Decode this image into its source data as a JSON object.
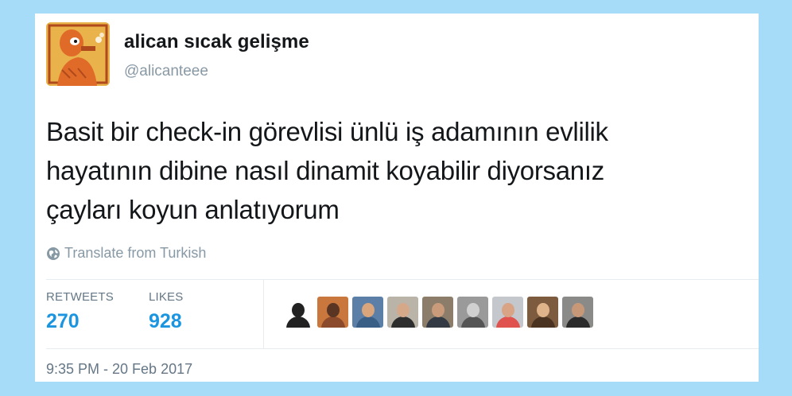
{
  "user": {
    "display_name": "alican sıcak gelişme",
    "handle": "@alicanteee"
  },
  "tweet": {
    "text": "Basit bir check-in görevlisi ünlü iş adamının evlilik\nhayatının dibine nasıl dinamit koyabilir diyorsanız\nçayları koyun anlatıyorum",
    "translate_label": "Translate from Turkish",
    "timestamp": "9:35 PM - 20 Feb 2017"
  },
  "stats": {
    "retweets_label": "RETWEETS",
    "retweets_value": "270",
    "likes_label": "LIKES",
    "likes_value": "928"
  },
  "colors": {
    "background": "#a6dcf7",
    "link_blue": "#1b95e0",
    "muted_gray": "#8899a6",
    "text": "#14171a"
  },
  "likers": [
    {
      "icon": "liker-avatar-1",
      "bg": "#ffffff",
      "face": "#222222",
      "body": "#222222"
    },
    {
      "icon": "liker-avatar-2",
      "bg": "#c9773d",
      "face": "#5a3524",
      "body": "#8a4a2b"
    },
    {
      "icon": "liker-avatar-3",
      "bg": "#5b7fa6",
      "face": "#d8a57c",
      "body": "#3a5f86"
    },
    {
      "icon": "liker-avatar-4",
      "bg": "#b9b3a8",
      "face": "#d6a88a",
      "body": "#2e2e2e"
    },
    {
      "icon": "liker-avatar-5",
      "bg": "#8c7d6a",
      "face": "#c99b7b",
      "body": "#333a44"
    },
    {
      "icon": "liker-avatar-6",
      "bg": "#9a9a9a",
      "face": "#d0d0d0",
      "body": "#555555"
    },
    {
      "icon": "liker-avatar-7",
      "bg": "#c4c8cc",
      "face": "#d9a385",
      "body": "#e0524e"
    },
    {
      "icon": "liker-avatar-8",
      "bg": "#7c5b3e",
      "face": "#e0b48a",
      "body": "#4a3321"
    },
    {
      "icon": "liker-avatar-9",
      "bg": "#8a8a88",
      "face": "#c79878",
      "body": "#2b2b2b"
    }
  ]
}
